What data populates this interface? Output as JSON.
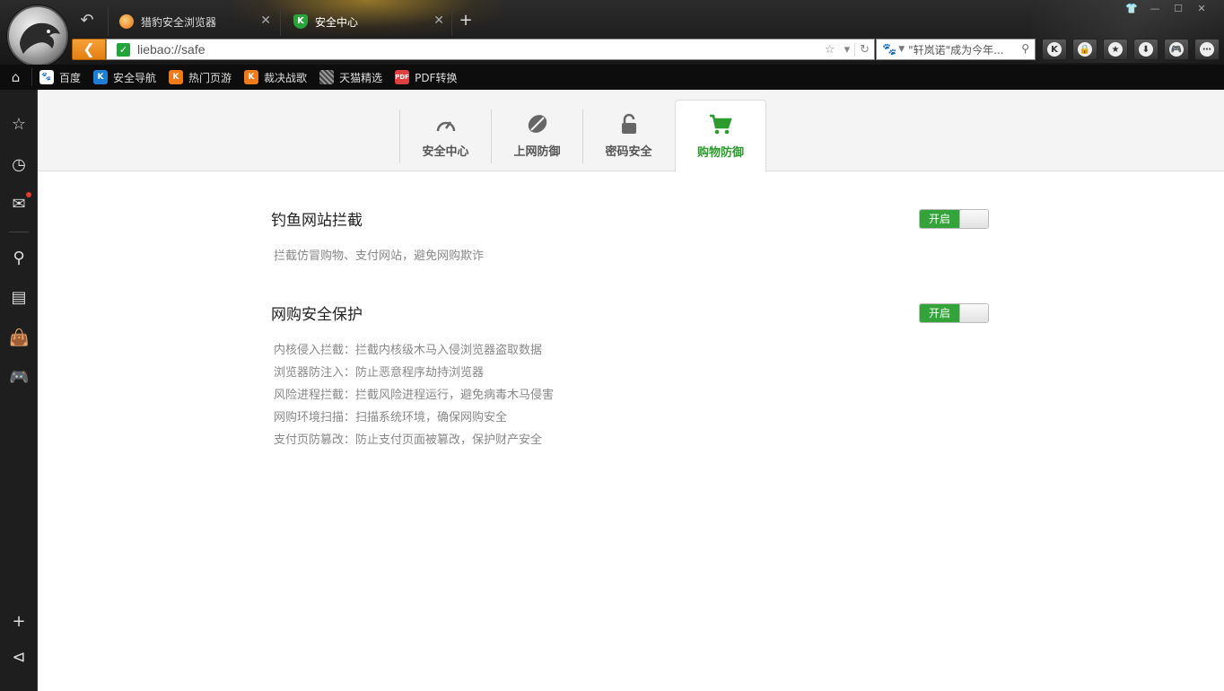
{
  "window": {
    "tabs": [
      {
        "title": "猎豹安全浏览器",
        "icon": "liebao-icon"
      },
      {
        "title": "安全中心",
        "icon": "kingsoft-shield-icon"
      }
    ],
    "new_tab_label": "+",
    "controls": [
      "skin-icon",
      "minimize-icon",
      "maximize-icon",
      "close-icon"
    ]
  },
  "addressbar": {
    "url": "liebao://safe",
    "secure_icon": "check-icon"
  },
  "searchbar": {
    "engine_icon": "baidu-paw-icon",
    "query": "\"轩岚诺\"成为今年..."
  },
  "toolbar": [
    "k-icon",
    "lock-icon",
    "star-icon",
    "download-icon",
    "gamepad-icon",
    "more-icon"
  ],
  "bookmarks": [
    {
      "label": "百度",
      "color": "#2a48c8"
    },
    {
      "label": "安全导航",
      "color": "#1e7fd6"
    },
    {
      "label": "热门页游",
      "color": "#f07a1a"
    },
    {
      "label": "裁决战歌",
      "color": "#f07a1a"
    },
    {
      "label": "天猫精选",
      "color": "#777777"
    },
    {
      "label": "PDF转换",
      "color": "#e04040"
    }
  ],
  "pdf_badge": "PDF",
  "sidebar": [
    "favorites-star-icon",
    "history-clock-icon",
    "inbox-icon",
    "search-icon",
    "news-icon",
    "shopping-bag-icon",
    "game-icon",
    "add-icon",
    "collapse-icon"
  ],
  "security_tabs": [
    {
      "label": "安全中心",
      "icon": "speedometer-icon"
    },
    {
      "label": "上网防御",
      "icon": "shield-leaf-icon"
    },
    {
      "label": "密码安全",
      "icon": "padlock-icon"
    },
    {
      "label": "购物防御",
      "icon": "shopping-cart-icon",
      "active": true
    }
  ],
  "accent_color": "#33a43a",
  "settings": [
    {
      "title": "钓鱼网站拦截",
      "toggle": "开启",
      "descriptions": [
        "拦截仿冒购物、支付网站，避免网购欺诈"
      ]
    },
    {
      "title": "网购安全保护",
      "toggle": "开启",
      "descriptions": [
        "内核侵入拦截：拦截内核级木马入侵浏览器盗取数据",
        "浏览器防注入：防止恶意程序劫持浏览器",
        "风险进程拦截：拦截风险进程运行，避免病毒木马侵害",
        "网购环境扫描：扫描系统环境，确保网购安全",
        "支付页防篡改：防止支付页面被篡改，保护财产安全"
      ]
    }
  ]
}
